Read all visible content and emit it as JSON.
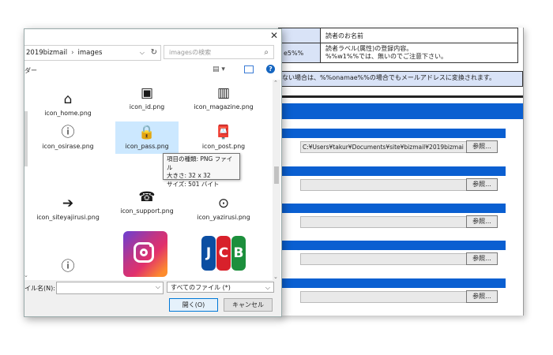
{
  "bg": {
    "vars": [
      {
        "key": "",
        "value": "読者のお名前"
      },
      {
        "key": "e5%%",
        "value": "読者ラベル(属性)の登録内容。\n%%w1%%では、無いのでご注意下さい。"
      }
    ],
    "note": "ない場合は、%%onamae%%の場合でもメールアドレスに変換されます。",
    "rows": [
      {
        "value": "C:¥Users¥takur¥Documents¥site¥bizmail¥2019bizmai",
        "browse": "参照..."
      },
      {
        "value": "",
        "browse": "参照..."
      },
      {
        "value": "",
        "browse": "参照..."
      },
      {
        "value": "",
        "browse": "参照..."
      },
      {
        "value": "",
        "browse": "参照..."
      }
    ]
  },
  "dialog": {
    "path": [
      "2019bizmail",
      "images"
    ],
    "search_placeholder": "imagesの検索",
    "organize_label": "ダー",
    "files": [
      {
        "name": "icon_home.png",
        "icon": "home-icon",
        "glyph": "⌂"
      },
      {
        "name": "icon_id.png",
        "icon": "id-card-icon",
        "glyph": "▣"
      },
      {
        "name": "icon_magazine.png",
        "icon": "books-icon",
        "glyph": "▥"
      },
      {
        "name": "icon_osirase.png",
        "icon": "info-icon",
        "glyph": "ⓘ"
      },
      {
        "name": "icon_pass.png",
        "icon": "padlock-icon",
        "glyph": "🔒"
      },
      {
        "name": "icon_post.png",
        "icon": "mailbox-icon",
        "glyph": "📮"
      },
      {
        "name": "icon_siteyajirusi.png",
        "icon": "arrow-right-icon",
        "glyph": "➔"
      },
      {
        "name": "icon_support.png",
        "icon": "support-icon",
        "glyph": "☎"
      },
      {
        "name": "icon_yazirusi.png",
        "icon": "circle-arrow-icon",
        "glyph": "⊙"
      },
      {
        "name": "",
        "icon": "exclamation-icon",
        "glyph": "ⓘ"
      }
    ],
    "tooltip": {
      "type": "項目の種類: PNG ファイル",
      "size": "大きさ: 32 x 32",
      "filesize": "サイズ: 501 バイト"
    },
    "filename_label": "イル名(N):",
    "filename_value": "",
    "filetype": "すべてのファイル (*)",
    "open_label": "開く(O)",
    "cancel_label": "キャンセル"
  }
}
